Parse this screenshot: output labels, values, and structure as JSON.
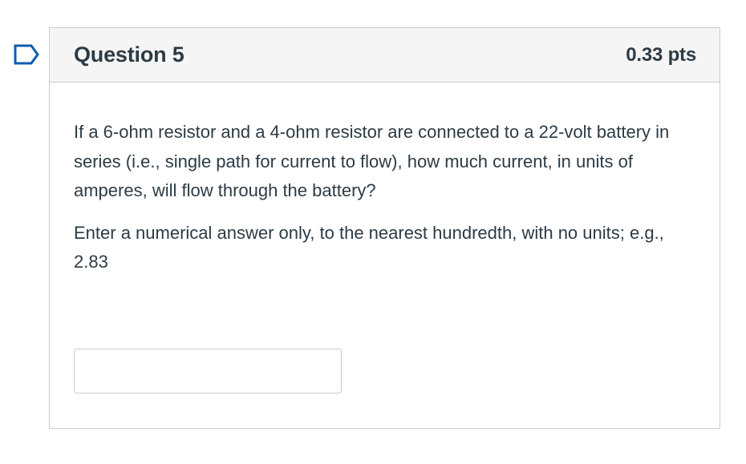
{
  "question": {
    "title": "Question 5",
    "points": "0.33 pts",
    "paragraphs": [
      "If a 6-ohm resistor and a 4-ohm resistor are connected to a 22-volt battery in series (i.e., single path for current to flow), how much current, in units of amperes, will flow through the battery?",
      "Enter a numerical answer only, to the nearest hundredth, with no units; e.g., 2.83"
    ],
    "answer": {
      "value": "",
      "placeholder": ""
    }
  },
  "flag": {
    "icon": "flag-icon",
    "color": "#0b5dab"
  },
  "colors": {
    "header_bg": "#f5f5f5",
    "border": "#c7cdd1",
    "text": "#2d3b45"
  }
}
